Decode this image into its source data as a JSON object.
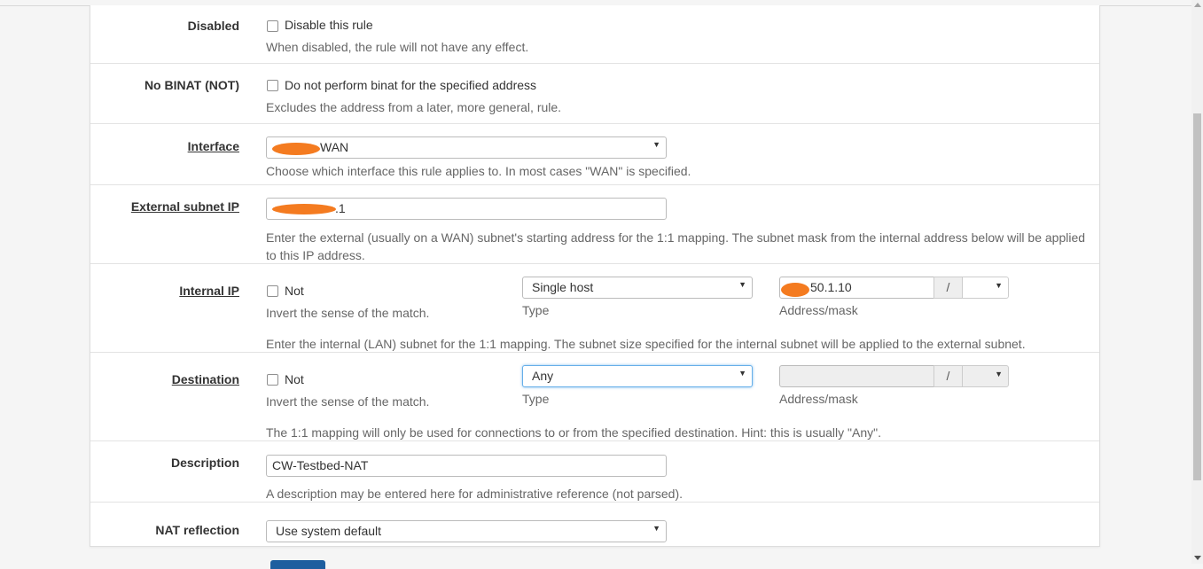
{
  "disabled": {
    "label": "Disabled",
    "checkbox_label": "Disable this rule",
    "help": "When disabled, the rule will not have any effect."
  },
  "nobinat": {
    "label": "No BINAT (NOT)",
    "checkbox_label": "Do not perform binat for the specified address",
    "help": "Excludes the address from a later, more general, rule."
  },
  "interface": {
    "label": "Interface",
    "value": "WAN",
    "help": "Choose which interface this rule applies to. In most cases \"WAN\" is specified."
  },
  "external": {
    "label": "External subnet IP",
    "value": ".1",
    "help": "Enter the external (usually on a WAN) subnet's starting address for the 1:1 mapping. The subnet mask from the internal address below will be applied to this IP address."
  },
  "internal": {
    "label": "Internal IP",
    "not_label": "Not",
    "invert_help": "Invert the sense of the match.",
    "type_value": "Single host",
    "type_label": "Type",
    "address_value": "50.1.10",
    "slash": "/",
    "address_label": "Address/mask",
    "help": "Enter the internal (LAN) subnet for the 1:1 mapping. The subnet size specified for the internal subnet will be applied to the external subnet."
  },
  "destination": {
    "label": "Destination",
    "not_label": "Not",
    "invert_help": "Invert the sense of the match.",
    "type_value": "Any",
    "type_label": "Type",
    "slash": "/",
    "address_label": "Address/mask",
    "help": "The 1:1 mapping will only be used for connections to or from the specified destination. Hint: this is usually \"Any\"."
  },
  "description": {
    "label": "Description",
    "value": "CW-Testbed-NAT",
    "help": "A description may be entered here for administrative reference (not parsed)."
  },
  "reflection": {
    "label": "NAT reflection",
    "value": "Use system default"
  },
  "caret": "▼",
  "colors": {
    "redaction": "#f47b20",
    "save_button": "#1e5e9f",
    "focus_border": "#66afe9"
  }
}
